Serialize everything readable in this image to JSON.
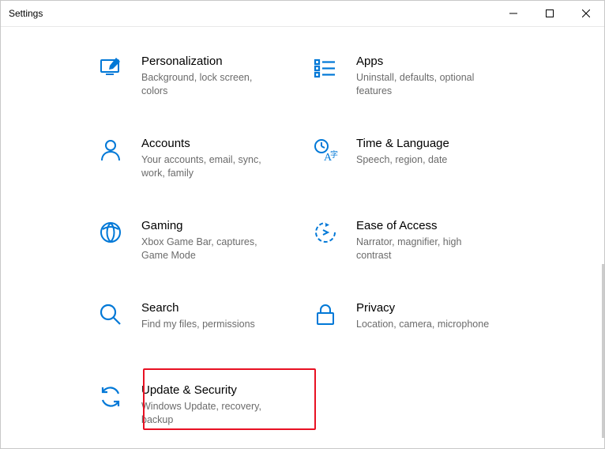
{
  "window": {
    "title": "Settings"
  },
  "accent": "#0078d7",
  "tiles": [
    {
      "key": "personalization",
      "title": "Personalization",
      "desc": "Background, lock screen, colors"
    },
    {
      "key": "apps",
      "title": "Apps",
      "desc": "Uninstall, defaults, optional features"
    },
    {
      "key": "accounts",
      "title": "Accounts",
      "desc": "Your accounts, email, sync, work, family"
    },
    {
      "key": "time-language",
      "title": "Time & Language",
      "desc": "Speech, region, date"
    },
    {
      "key": "gaming",
      "title": "Gaming",
      "desc": "Xbox Game Bar, captures, Game Mode"
    },
    {
      "key": "ease-of-access",
      "title": "Ease of Access",
      "desc": "Narrator, magnifier, high contrast"
    },
    {
      "key": "search",
      "title": "Search",
      "desc": "Find my files, permissions"
    },
    {
      "key": "privacy",
      "title": "Privacy",
      "desc": "Location, camera, microphone"
    },
    {
      "key": "update-security",
      "title": "Update & Security",
      "desc": "Windows Update, recovery, backup"
    }
  ]
}
